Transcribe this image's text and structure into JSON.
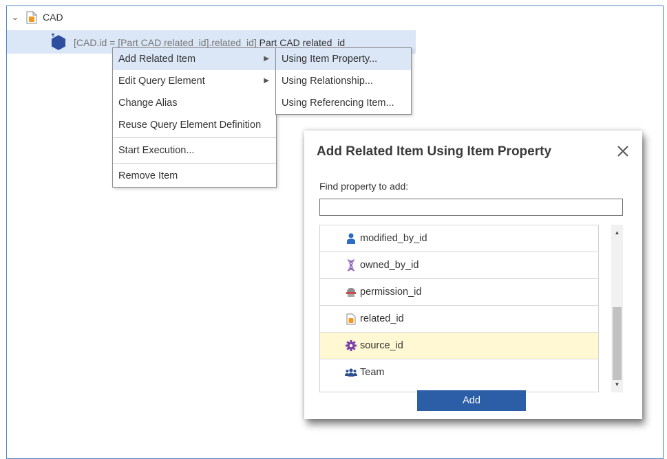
{
  "tree": {
    "root_label": "CAD",
    "node": {
      "text_prefix": "[CAD.id = [Part CAD related_id].related_id]",
      "text_suffix": "Part CAD related_id"
    }
  },
  "context_menu": {
    "items": [
      {
        "label": "Add Related Item",
        "submenu": true,
        "highlighted": true
      },
      {
        "label": "Edit Query Element",
        "submenu": true
      },
      {
        "label": "Change Alias"
      },
      {
        "label": "Reuse Query Element Definition"
      },
      {
        "label": "Start Execution..."
      },
      {
        "label": "Remove Item"
      }
    ]
  },
  "submenu": {
    "items": [
      {
        "label": "Using Item Property...",
        "highlighted": true
      },
      {
        "label": "Using Relationship..."
      },
      {
        "label": "Using Referencing Item..."
      }
    ]
  },
  "dialog": {
    "title": "Add Related Item Using Item Property",
    "find_label": "Find property to add:",
    "find_value": "",
    "properties": [
      {
        "label": "modified_by_id",
        "icon": "user-icon"
      },
      {
        "label": "owned_by_id",
        "icon": "identity-icon"
      },
      {
        "label": "permission_id",
        "icon": "permission-icon"
      },
      {
        "label": "related_id",
        "icon": "document-icon"
      },
      {
        "label": "source_id",
        "icon": "gear-icon",
        "selected": true
      },
      {
        "label": "Team",
        "icon": "team-icon"
      }
    ],
    "add_label": "Add"
  },
  "colors": {
    "selection": "#dbe6f6",
    "row_selected": "#fff8d2",
    "add_button": "#2b5ea7",
    "frame": "#4f86c6"
  }
}
